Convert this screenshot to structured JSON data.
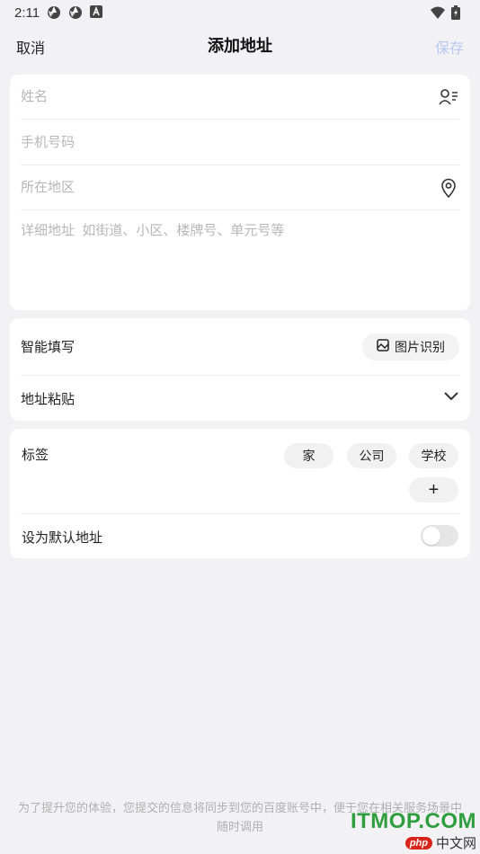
{
  "status_bar": {
    "time": "2:11",
    "icons": [
      "aperture-icon",
      "aperture-icon",
      "font-a-icon",
      "wifi-icon",
      "battery-icon"
    ]
  },
  "nav": {
    "cancel_label": "取消",
    "title": "添加地址",
    "save_label": "保存",
    "save_color": "#b8c8f0"
  },
  "address_form": {
    "name_placeholder": "姓名",
    "phone_placeholder": "手机号码",
    "region_placeholder": "所在地区",
    "detail_placeholder": "详细地址  如街道、小区、楼牌号、单元号等"
  },
  "smart_fill": {
    "label": "智能填写",
    "image_recognition_label": "图片识别",
    "paste_label": "地址粘贴"
  },
  "tags": {
    "label": "标签",
    "items": [
      "家",
      "公司",
      "学校"
    ],
    "add_symbol": "+"
  },
  "default_address": {
    "label": "设为默认地址",
    "enabled": false
  },
  "footer": {
    "note": "为了提升您的体验，您提交的信息将同步到您的百度账号中，便于您在相关服务场景中随时调用"
  },
  "watermark": {
    "top": "ITMOP.COM",
    "logo": "php",
    "site": "中文网"
  }
}
